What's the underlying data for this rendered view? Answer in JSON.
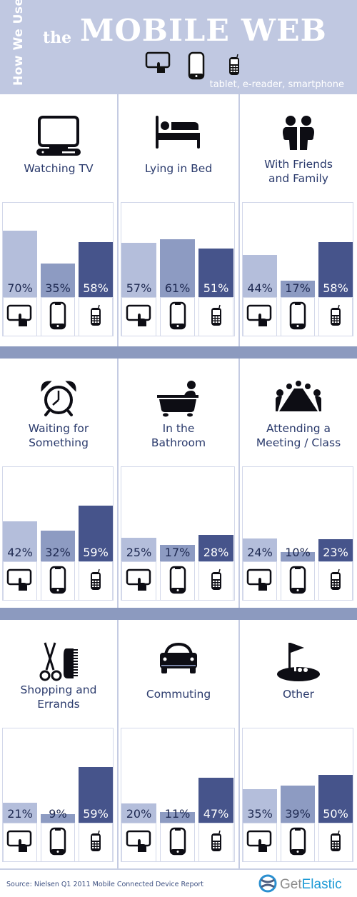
{
  "header": {
    "side_text": "How We Use",
    "the": "the",
    "title": "MOBILE WEB",
    "subtitle": "tablet, e-reader, smartphone",
    "device_icons": [
      "tablet-icon",
      "e-reader-icon",
      "smartphone-icon"
    ]
  },
  "colors": {
    "header_bg": "#c0c8e1",
    "band": "#8c9abf",
    "tablet_bar": "#b4bedb",
    "ereader_bar": "#8d9bc2",
    "smartphone_bar": "#46548b",
    "label_text": "#2a3a6c"
  },
  "chart_data": {
    "type": "bar",
    "title": "How We Use the Mobile Web",
    "series_names": [
      "Tablet",
      "E-reader",
      "Smartphone"
    ],
    "unit": "%",
    "ylim": [
      0,
      100
    ],
    "panels": [
      {
        "label": "Watching TV",
        "icon": "tv-icon",
        "values": [
          70,
          35,
          58
        ],
        "labels": [
          "70%",
          "35%",
          "58%"
        ]
      },
      {
        "label": "Lying in Bed",
        "icon": "bed-icon",
        "values": [
          57,
          61,
          51
        ],
        "labels": [
          "57%",
          "61%",
          "51%"
        ]
      },
      {
        "label": "With Friends\nand Family",
        "icon": "friends-icon",
        "values": [
          44,
          17,
          58
        ],
        "labels": [
          "44%",
          "17%",
          "58%"
        ]
      },
      {
        "label": "Waiting for\nSomething",
        "icon": "alarm-clock-icon",
        "values": [
          42,
          32,
          59
        ],
        "labels": [
          "42%",
          "32%",
          "59%"
        ]
      },
      {
        "label": "In the\nBathroom",
        "icon": "bathtub-icon",
        "values": [
          25,
          17,
          28
        ],
        "labels": [
          "25%",
          "17%",
          "28%"
        ]
      },
      {
        "label": "Attending a\nMeeting / Class",
        "icon": "meeting-icon",
        "values": [
          24,
          10,
          23
        ],
        "labels": [
          "24%",
          "10%",
          "23%"
        ]
      },
      {
        "label": "Shopping and\nErrands",
        "icon": "scissors-comb-icon",
        "values": [
          21,
          9,
          59
        ],
        "labels": [
          "21%",
          "9%",
          "59%"
        ]
      },
      {
        "label": "Commuting",
        "icon": "car-icon",
        "values": [
          20,
          11,
          47
        ],
        "labels": [
          "20%",
          "11%",
          "47%"
        ]
      },
      {
        "label": "Other",
        "icon": "golf-flag-icon",
        "values": [
          35,
          39,
          50
        ],
        "labels": [
          "35%",
          "39%",
          "50%"
        ]
      }
    ]
  },
  "footer": {
    "source": "Source: Nielsen Q1 2011 Mobile Connected Device Report",
    "logo_get": "Get",
    "logo_elastic": "Elastic"
  }
}
